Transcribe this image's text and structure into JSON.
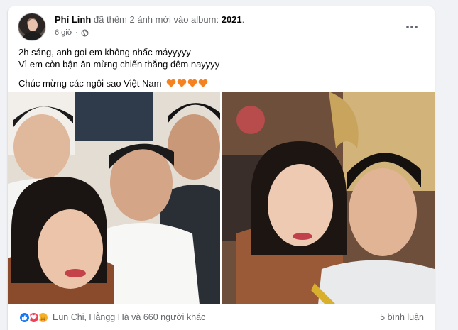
{
  "post": {
    "author": "Phí Linh",
    "action_text": "đã thêm 2 ảnh mới vào album:",
    "album": "2021",
    "time": "6 giờ",
    "privacy_icon": "globe-icon",
    "more_icon": "more-options-icon",
    "text_lines": [
      "2h sáng, anh gọi em không nhấc máyyyyy",
      "Vì em còn bận ăn mừng chiến thắng đêm nayyyy"
    ],
    "congrats": "Chúc mừng các ngôi sao Việt Nam",
    "congrats_emoji": "orange-heart-icon x4"
  },
  "photos": [
    {
      "name": "group-selfie-four-people"
    },
    {
      "name": "selfie-two-people"
    }
  ],
  "footer": {
    "reaction_icons": [
      "like-icon",
      "love-icon",
      "care-icon"
    ],
    "reaction_names": "Eun Chi, Hằngg Hà và 660 người khác",
    "comment_count": "5 bình luận"
  },
  "colors": {
    "page_bg": "#f0f2f5",
    "card_bg": "#ffffff",
    "secondary_text": "#65676b",
    "like_blue": "#1877f2",
    "love_red": "#f33e58",
    "care_yellow": "#f7b125",
    "heart_orange": "#f5821f"
  }
}
